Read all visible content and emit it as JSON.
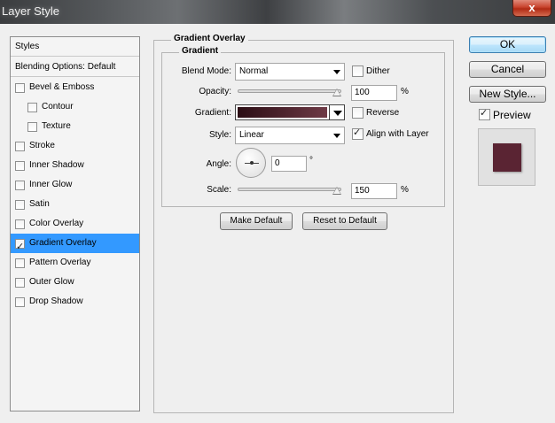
{
  "window": {
    "title": "Layer Style",
    "close_glyph": "x"
  },
  "sidebar": {
    "styles_header": "Styles",
    "blending_options": "Blending Options: Default",
    "items": [
      {
        "label": "Bevel & Emboss",
        "checked": false,
        "indent": 0
      },
      {
        "label": "Contour",
        "checked": false,
        "indent": 1
      },
      {
        "label": "Texture",
        "checked": false,
        "indent": 1
      },
      {
        "label": "Stroke",
        "checked": false,
        "indent": 0
      },
      {
        "label": "Inner Shadow",
        "checked": false,
        "indent": 0
      },
      {
        "label": "Inner Glow",
        "checked": false,
        "indent": 0
      },
      {
        "label": "Satin",
        "checked": false,
        "indent": 0
      },
      {
        "label": "Color Overlay",
        "checked": false,
        "indent": 0
      },
      {
        "label": "Gradient Overlay",
        "checked": true,
        "indent": 0,
        "selected": true
      },
      {
        "label": "Pattern Overlay",
        "checked": false,
        "indent": 0
      },
      {
        "label": "Outer Glow",
        "checked": false,
        "indent": 0
      },
      {
        "label": "Drop Shadow",
        "checked": false,
        "indent": 0
      }
    ],
    "selected_color": "#3399ff"
  },
  "panel": {
    "group_title": "Gradient Overlay",
    "subgroup_title": "Gradient",
    "blend_mode": {
      "label": "Blend Mode:",
      "value": "Normal"
    },
    "dither": {
      "label": "Dither",
      "checked": false
    },
    "opacity": {
      "label": "Opacity:",
      "value": "100",
      "unit": "%",
      "level": 1.0
    },
    "gradient": {
      "label": "Gradient:",
      "colors": [
        "#2b0d14",
        "#6e3a46"
      ]
    },
    "reverse": {
      "label": "Reverse",
      "checked": false
    },
    "style": {
      "label": "Style:",
      "value": "Linear"
    },
    "align_with_layer": {
      "label": "Align with Layer",
      "checked": true
    },
    "angle": {
      "label": "Angle:",
      "value": "0",
      "unit": "°"
    },
    "scale": {
      "label": "Scale:",
      "value": "150",
      "unit": "%",
      "level": 1.0
    },
    "make_default": "Make Default",
    "reset_to_default": "Reset to Default"
  },
  "actions": {
    "ok": "OK",
    "cancel": "Cancel",
    "new_style": "New Style...",
    "preview": {
      "label": "Preview",
      "checked": true
    },
    "preview_color": "#5a2433"
  },
  "checkmark": "✓"
}
